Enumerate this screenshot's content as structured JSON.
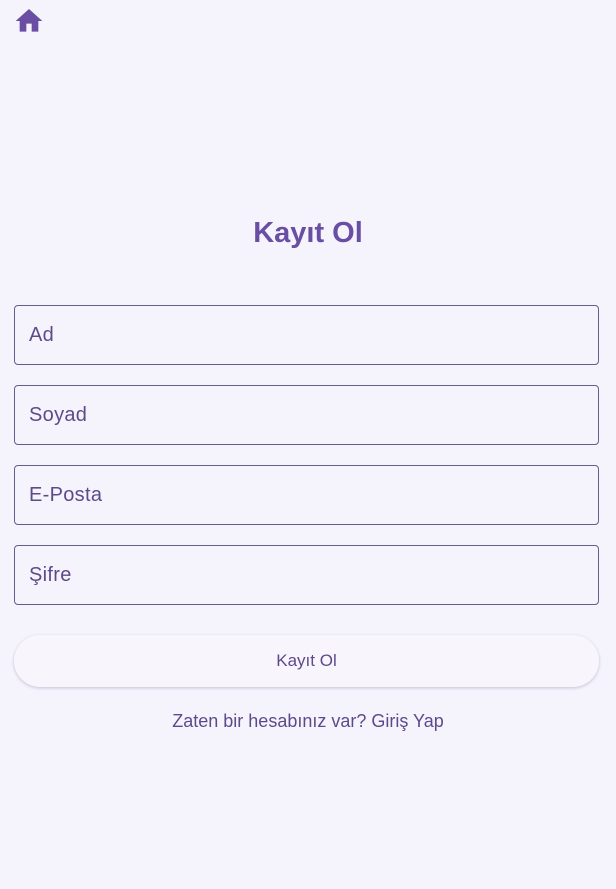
{
  "header": {
    "home_icon": "home-icon"
  },
  "page": {
    "title": "Kayıt Ol"
  },
  "form": {
    "first_name_placeholder": "Ad",
    "last_name_placeholder": "Soyad",
    "email_placeholder": "E-Posta",
    "password_placeholder": "Şifre",
    "submit_label": "Kayıt Ol",
    "login_prompt": "Zaten bir hesabınız var? Giriş Yap"
  },
  "colors": {
    "background": "#f5f4fd",
    "accent": "#6a4ea3",
    "field_border": "#6b5a8e",
    "text": "#5e4a8a"
  }
}
